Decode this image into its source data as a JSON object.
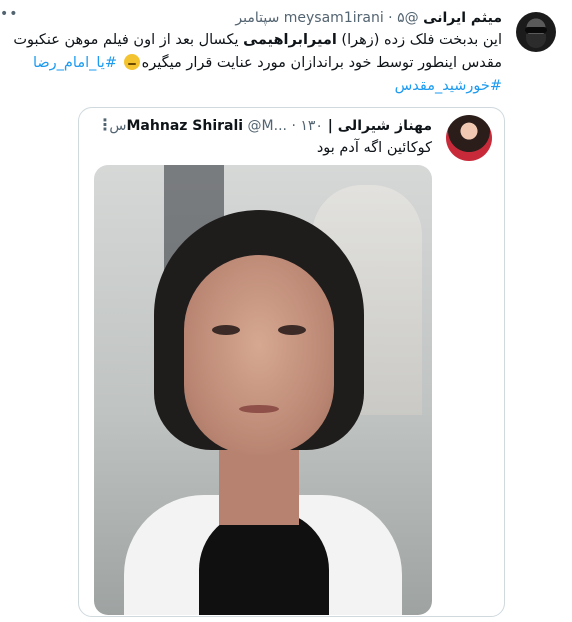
{
  "tweet": {
    "author_name": "میثم ایرانی",
    "handle": "@meysam1irani",
    "separator": "·",
    "timestamp": "۵ سپتامبر",
    "text_line1_pre": "این بدبخت فلک زده (زهرا) ",
    "text_line1_bold": "امیرابراهیمی",
    "text_line1_post": " یکسال بعد از اون فیلم موهن عنکبوت",
    "text_line2": "مقدس اینطور توسط خود براندازان مورد عنایت قرار میگیره",
    "hashtag1": "#یا_امام_رضا",
    "hashtag2": "#خورشید_مقدس",
    "more_dots": "••"
  },
  "quoted": {
    "name": "مهناز شیرالی | Mahnaz Shirali",
    "handle": "@M...",
    "separator": "·",
    "time": "۱۳۰س",
    "menu": "⋮",
    "text": "کوکائین اگه آدم بود"
  },
  "icons": [
    "avatar",
    "emoji-neutral-face",
    "more-dots-icon",
    "kebab-menu-icon"
  ],
  "colors": {
    "link": "#1d9bf0",
    "muted": "#536471",
    "border": "#cfd9de"
  }
}
